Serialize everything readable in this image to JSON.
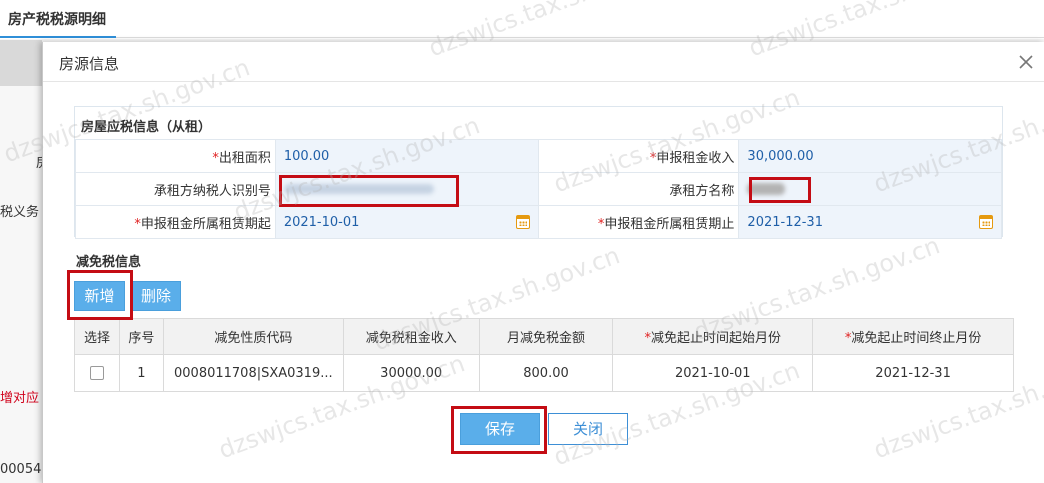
{
  "top_tab": {
    "label": "房产税税源明细"
  },
  "background": {
    "text1": "房",
    "text2": "税义务",
    "text3": "增对应",
    "text4": "00054"
  },
  "dialog": {
    "title": "房源信息",
    "close_icon": "close-icon",
    "section": {
      "title": "房屋应税信息（从租）",
      "rows": [
        {
          "left_required": true,
          "left_label": "出租面积",
          "left_value": "100.00",
          "right_required": true,
          "right_label": "申报租金收入",
          "right_value": "30,000.00"
        },
        {
          "left_required": false,
          "left_label": "承租方纳税人识别号",
          "left_value": "",
          "right_required": false,
          "right_label": "承租方名称",
          "right_value": ""
        },
        {
          "left_required": true,
          "left_label": "申报租金所属租赁期起",
          "left_value": "2021-10-01",
          "right_required": true,
          "right_label": "申报租金所属租赁期止",
          "right_value": "2021-12-31"
        }
      ]
    },
    "exemption": {
      "title": "减免税信息",
      "add_button": "新增",
      "delete_button": "删除",
      "columns": [
        "选择",
        "序号",
        "减免性质代码",
        "减免税租金收入",
        "月减免税金额",
        "减免起止时间起始月份",
        "减免起止时间终止月份"
      ],
      "required_columns": [
        5,
        6
      ],
      "rows": [
        {
          "seq": "1",
          "code": "0008011708|SXA0319...",
          "income": "30000.00",
          "monthly": "800.00",
          "start": "2021-10-01",
          "end": "2021-12-31"
        }
      ]
    },
    "save_button": "保存",
    "close_button": "关闭"
  },
  "watermark_text": "dzswjcs.tax.sh.gov.cn",
  "colors": {
    "accent": "#5aaeea",
    "highlight_border": "#c40c14",
    "required": "#e02020",
    "value_text": "#1f5fa8",
    "value_bg": "#eef4fb"
  }
}
